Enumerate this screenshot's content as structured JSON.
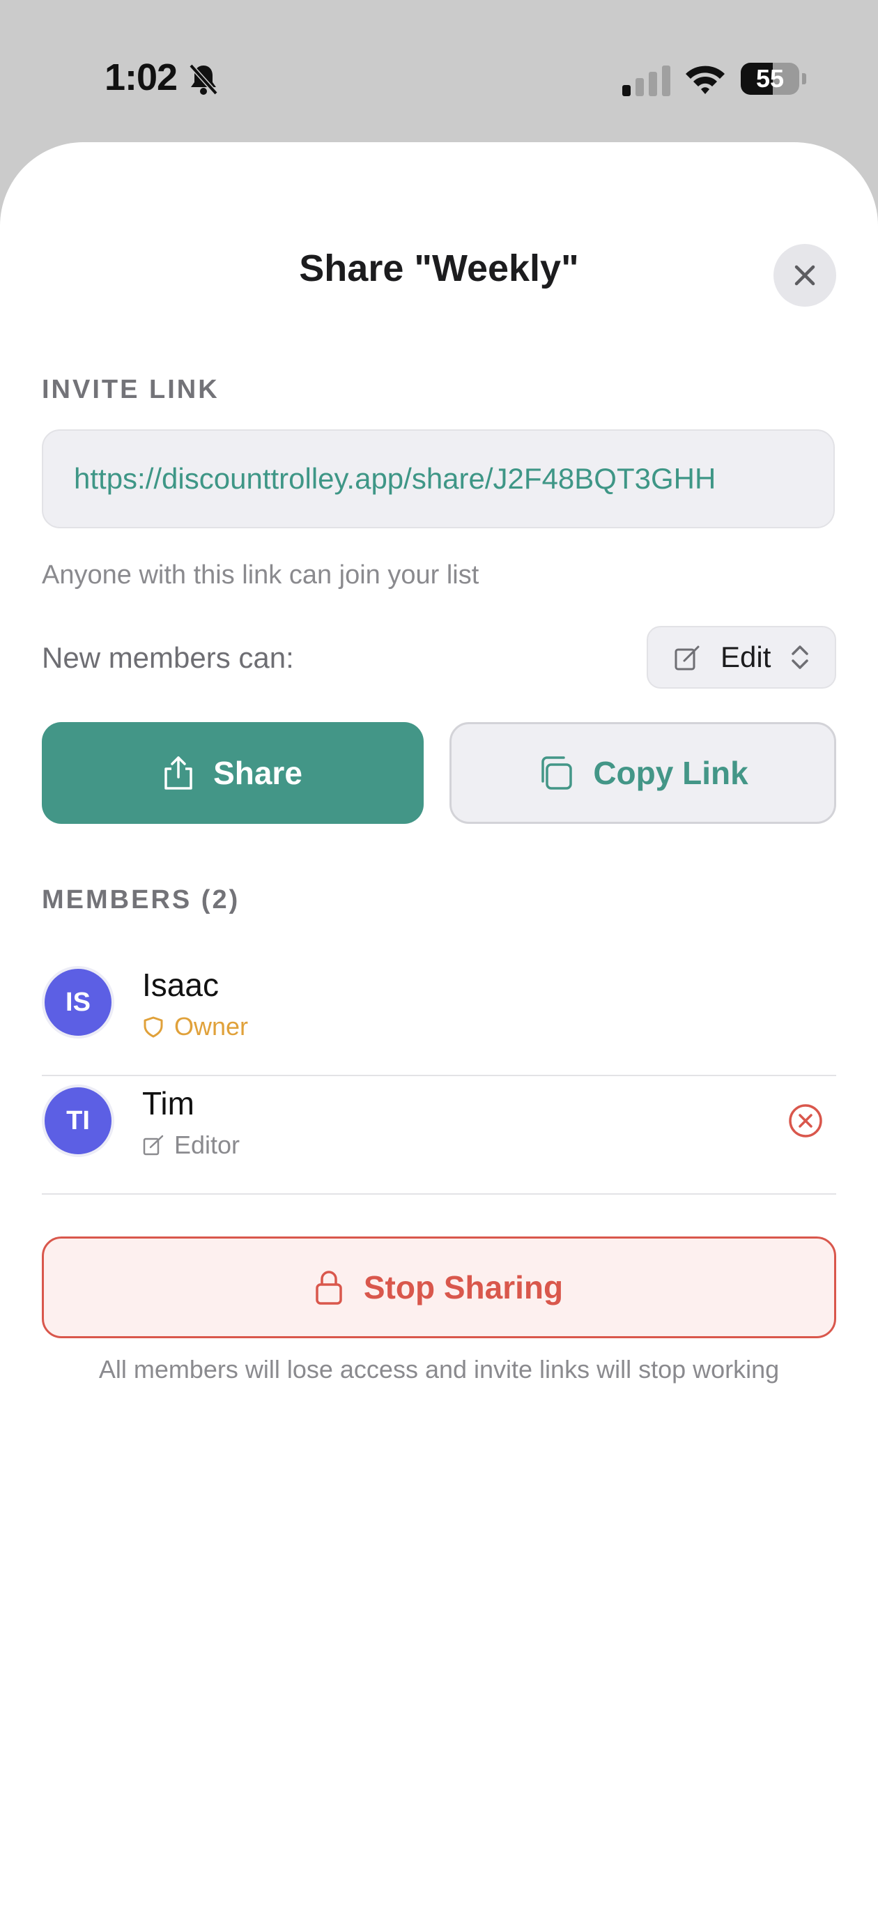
{
  "status_bar": {
    "time": "1:02",
    "battery_level": "55",
    "battery_fraction": 0.55
  },
  "sheet": {
    "title": "Share \"Weekly\"",
    "close_icon": "close-icon"
  },
  "invite": {
    "section_label": "INVITE LINK",
    "url": "https://discounttrolley.app/share/J2F48BQT3GHH",
    "hint": "Anyone with this link can join your list",
    "permission_label": "New members can:",
    "permission_value": "Edit"
  },
  "actions": {
    "share_label": "Share",
    "copy_label": "Copy Link"
  },
  "members": {
    "section_label": "MEMBERS (2)",
    "list": [
      {
        "initials": "IS",
        "name": "Isaac",
        "role": "Owner",
        "role_icon": "shield-icon",
        "role_color": "#e0a13a"
      },
      {
        "initials": "TI",
        "name": "Tim",
        "role": "Editor",
        "role_icon": "edit-icon",
        "role_color": "#8a8a8e"
      }
    ]
  },
  "danger": {
    "stop_label": "Stop Sharing",
    "footnote": "All members will lose access and invite links will stop working"
  },
  "colors": {
    "accent": "#439687",
    "avatar": "#5c5fe4",
    "danger": "#d9574c",
    "owner": "#e0a13a"
  }
}
